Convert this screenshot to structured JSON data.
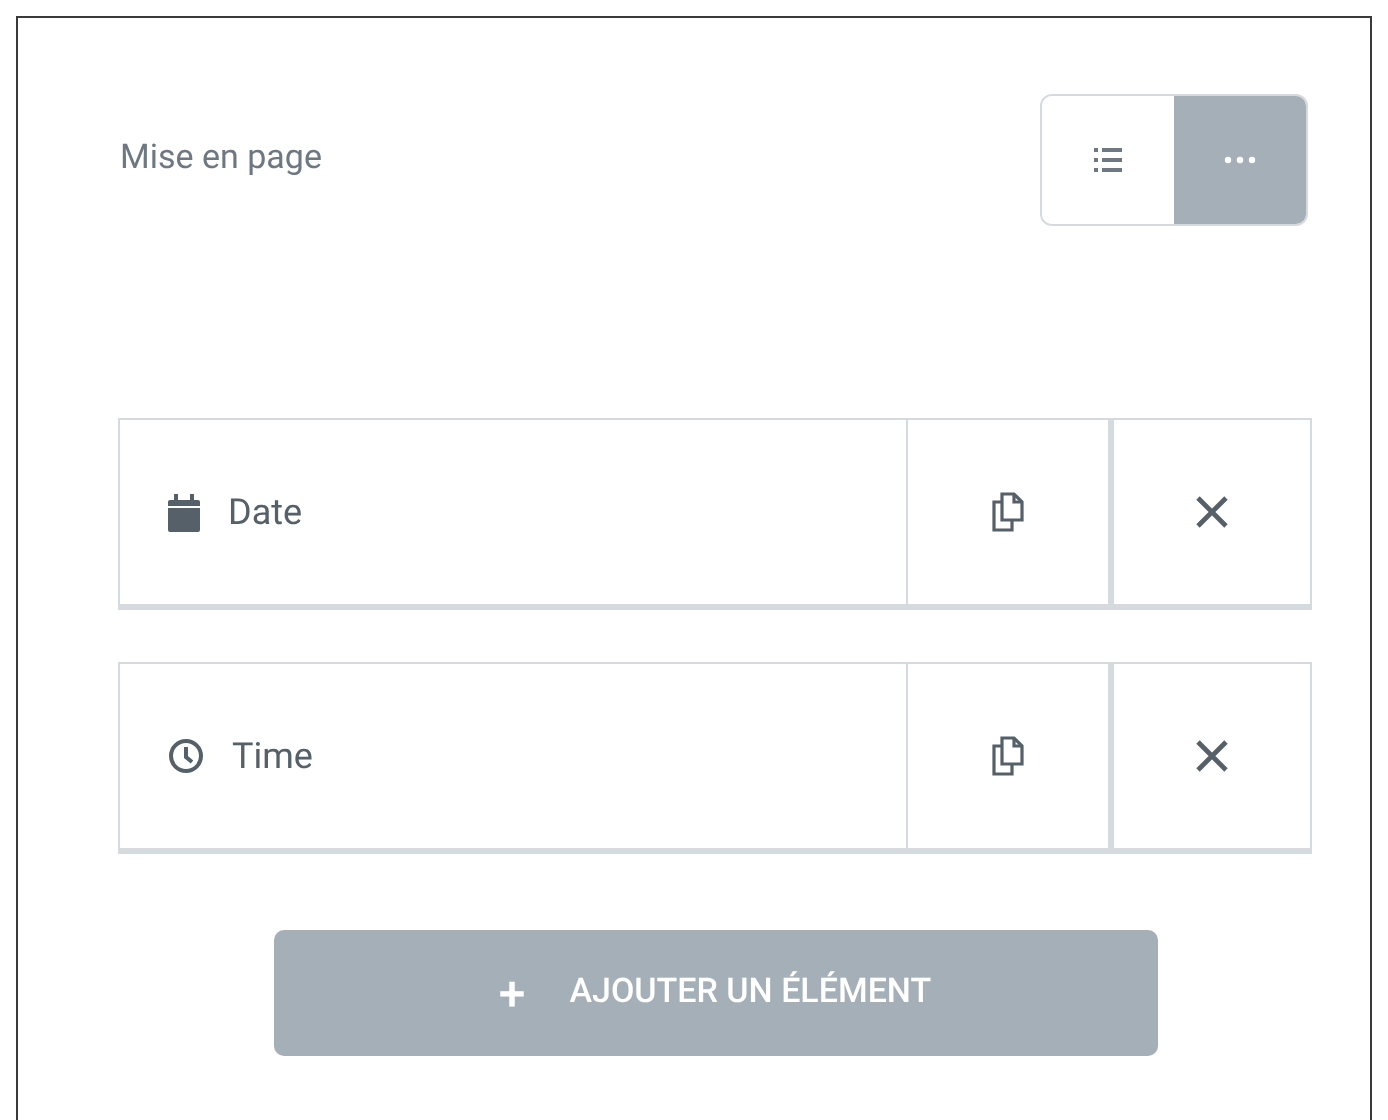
{
  "section": {
    "title": "Mise en page"
  },
  "view_toggle": [
    {
      "kind": "list",
      "selected": false
    },
    {
      "kind": "more",
      "selected": true
    }
  ],
  "items": [
    {
      "kind": "date",
      "label": "Date"
    },
    {
      "kind": "time",
      "label": "Time"
    }
  ],
  "add_button": {
    "icon": "+",
    "label": "AJOUTER UN ÉLÉMENT"
  }
}
